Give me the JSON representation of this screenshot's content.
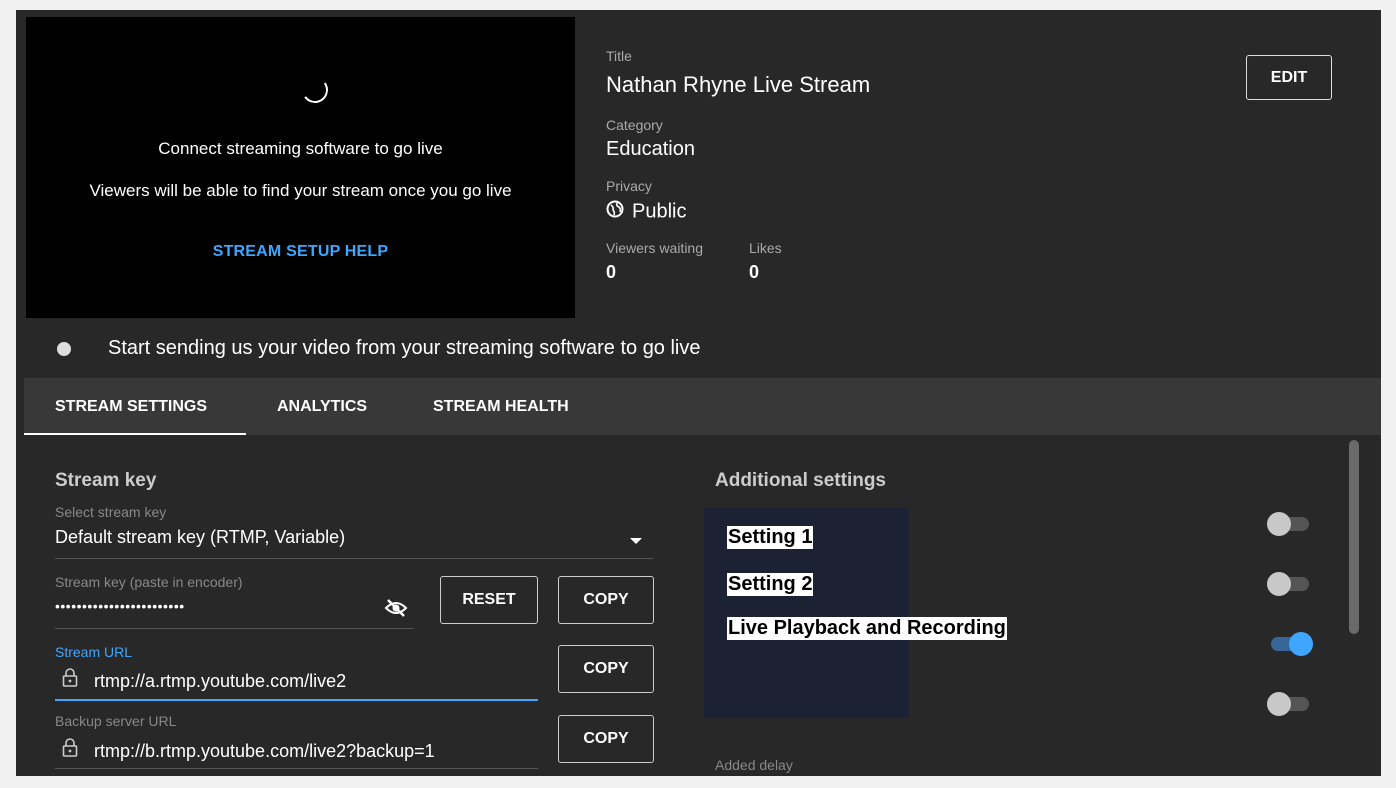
{
  "preview": {
    "message": "Connect streaming software to go live",
    "sub_message": "Viewers will be able to find your stream once you go live",
    "help_link": "STREAM SETUP HELP"
  },
  "info": {
    "title_label": "Title",
    "title": "Nathan Rhyne Live Stream",
    "category_label": "Category",
    "category": "Education",
    "privacy_label": "Privacy",
    "privacy": "Public",
    "viewers_label": "Viewers waiting",
    "viewers": "0",
    "likes_label": "Likes",
    "likes": "0",
    "edit_label": "EDIT"
  },
  "status": {
    "text": "Start sending us your video from your streaming software to go live"
  },
  "tabs": [
    {
      "label": "STREAM SETTINGS",
      "active": true
    },
    {
      "label": "ANALYTICS",
      "active": false
    },
    {
      "label": "STREAM HEALTH",
      "active": false
    }
  ],
  "stream_key": {
    "section_title": "Stream key",
    "select_label": "Select stream key",
    "select_value": "Default stream key (RTMP, Variable)",
    "key_label": "Stream key (paste in encoder)",
    "key_value": "••••••••••••••••••••••••",
    "reset_label": "RESET",
    "copy_label": "COPY",
    "url_label": "Stream URL",
    "url_value": "rtmp://a.rtmp.youtube.com/live2",
    "backup_label": "Backup server URL",
    "backup_value": "rtmp://b.rtmp.youtube.com/live2?backup=1"
  },
  "additional": {
    "section_title": "Additional settings",
    "settings": [
      {
        "label": "Setting 1",
        "enabled": false
      },
      {
        "label": "Setting 2",
        "enabled": false
      },
      {
        "label": "Live Playback and Recording",
        "enabled": true
      },
      {
        "label": "",
        "enabled": false
      }
    ],
    "added_delay_label": "Added delay"
  },
  "colors": {
    "accent": "#3ea6ff",
    "panel": "#282828",
    "tabbar": "#383838"
  }
}
